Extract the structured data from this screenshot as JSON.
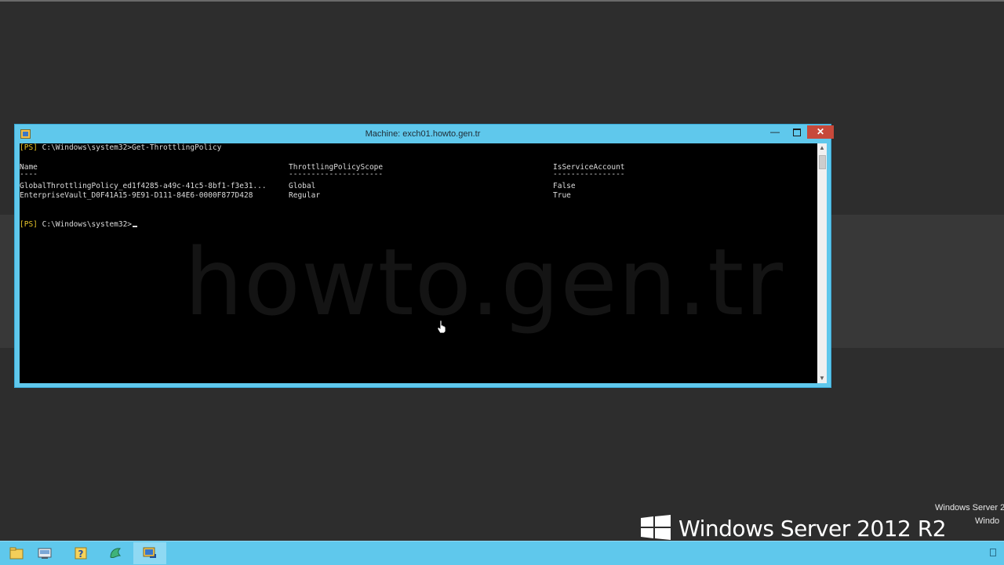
{
  "window": {
    "title": "Machine: exch01.howto.gen.tr",
    "buttons": {
      "minimize": "—",
      "maximize": "",
      "close": "✕"
    }
  },
  "console": {
    "prompt_tag": "[PS]",
    "prompt_path": "C:\\Windows\\system32>",
    "command": "Get-ThrottlingPolicy",
    "table": {
      "headers": [
        "Name",
        "ThrottlingPolicyScope",
        "IsServiceAccount"
      ],
      "underlines": [
        "----",
        "---------------------",
        "----------------"
      ],
      "rows": [
        [
          "GlobalThrottlingPolicy_ed1f4285-a49c-41c5-8bf1-f3e31...",
          "Global",
          "False"
        ],
        [
          "EnterpriseVault_D0F41A15-9E91-D111-84E6-0000F877D428",
          "Regular",
          "True"
        ]
      ]
    },
    "final_prompt_path": "C:\\Windows\\system32>"
  },
  "watermark": "howto.gen.tr",
  "desktop": {
    "brand": "Windows Server 2012 R2",
    "edition_line1": "Windows Server 2",
    "edition_line2": "Windo"
  },
  "taskbar": {
    "items": [
      "file-explorer",
      "server-manager",
      "help",
      "exchange-shell",
      "powershell-remote"
    ]
  },
  "colors": {
    "window_frame": "#5fc8ec",
    "close_button": "#c7493b",
    "prompt_tag": "#e8c52a",
    "console_bg": "#000000",
    "desktop_bg": "#2d2d2d"
  }
}
